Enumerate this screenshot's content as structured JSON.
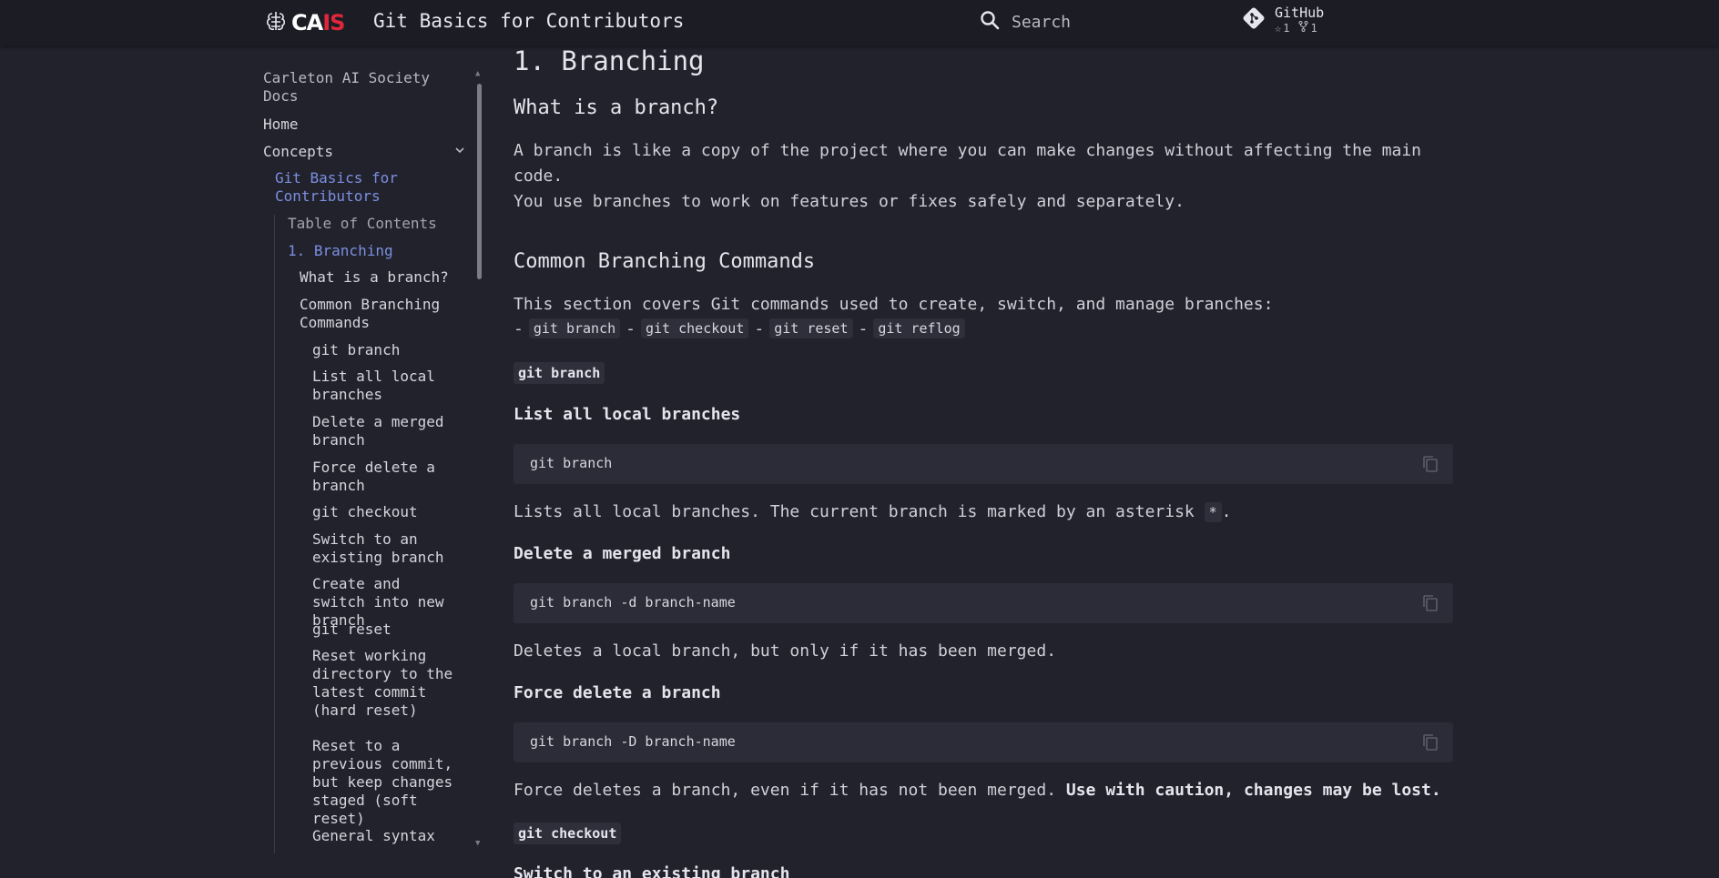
{
  "header": {
    "logo_text": "CAIS",
    "logo_red": "IS",
    "logo_white": "CA",
    "site_title": "Git Basics for Contributors",
    "search_label": "Search",
    "repo_name": "GitHub",
    "stars": "1",
    "forks": "1"
  },
  "sidebar": {
    "root": "Carleton AI Society Docs",
    "items": [
      {
        "label": "Home"
      },
      {
        "label": "Concepts"
      },
      {
        "label": "Git Basics for Contributors"
      },
      {
        "label": "Table of Contents"
      },
      {
        "label": "1. Branching"
      },
      {
        "label": "What is a branch?"
      },
      {
        "label": "Common Branching Commands"
      },
      {
        "label": "git branch"
      },
      {
        "label": "List all local branches"
      },
      {
        "label": "Delete a merged branch"
      },
      {
        "label": "Force delete a branch"
      },
      {
        "label": "git checkout"
      },
      {
        "label": "Switch to an existing branch"
      },
      {
        "label": "Create and switch into new branch"
      },
      {
        "label": "git reset"
      },
      {
        "label": "Reset working directory to the latest commit (hard reset)"
      },
      {
        "label": "Reset to a previous commit, but keep changes staged (soft reset)"
      },
      {
        "label": "General syntax"
      }
    ]
  },
  "content": {
    "h1": "1. Branching",
    "what_heading": "What is a branch?",
    "what_p1": "A branch is like a copy of the project where you can make changes without affecting the main code.",
    "what_p2": "You use branches to work on features or fixes safely and separately.",
    "common_heading": "Common Branching Commands",
    "common_p": "This section covers Git commands used to create, switch, and manage branches:",
    "dash": "-",
    "cmds": [
      "git branch",
      "git checkout",
      "git reset",
      "git reflog"
    ],
    "git_branch_badge": "git branch",
    "list_heading": "List all local branches",
    "list_code": "git branch",
    "list_p_pre": "Lists all local branches. The current branch is marked by an asterisk",
    "list_p_code": "*",
    "list_p_post": ".",
    "delete_heading": "Delete a merged branch",
    "delete_code": "git branch -d branch-name",
    "delete_p": "Deletes a local branch, but only if it has been merged.",
    "force_heading": "Force delete a branch",
    "force_code": "git branch -D branch-name",
    "force_p": "Force deletes a branch, even if it has not been merged.",
    "force_p_bold": "Use with caution, changes may be lost.",
    "checkout_badge": "git checkout",
    "switch_heading": "Switch to an existing branch"
  },
  "colors": {
    "background": "#21222c",
    "header_bg": "#1b1c24",
    "accent_link": "#7c8fe0",
    "code_bg": "#2b2c37",
    "logo_red": "#e0263a"
  }
}
